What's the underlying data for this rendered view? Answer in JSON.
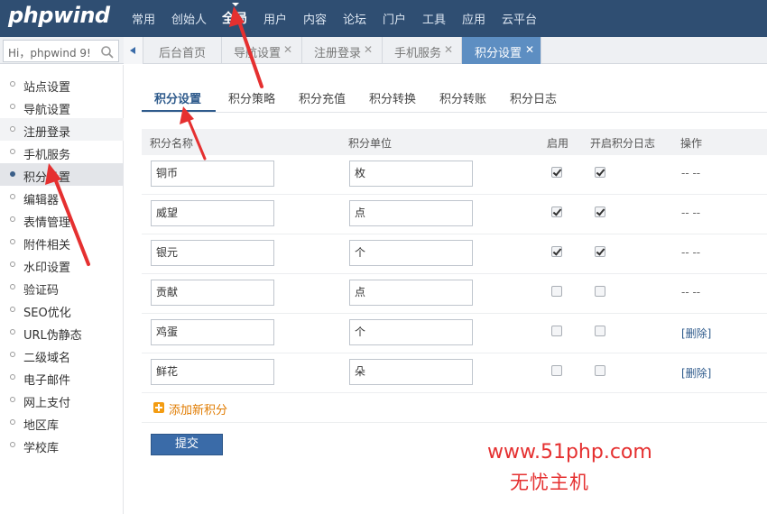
{
  "logo": "phpwind",
  "nav": {
    "items": [
      "常用",
      "创始人",
      "全局",
      "用户",
      "内容",
      "论坛",
      "门户",
      "工具",
      "应用",
      "云平台"
    ],
    "active_index": 2
  },
  "search": {
    "placeholder": "Hi，phpwind 9!"
  },
  "tabs": [
    {
      "label": "后台首页",
      "closable": false
    },
    {
      "label": "导航设置",
      "closable": true
    },
    {
      "label": "注册登录",
      "closable": true
    },
    {
      "label": "手机服务",
      "closable": true
    },
    {
      "label": "积分设置",
      "closable": true,
      "active": true
    }
  ],
  "sidebar": {
    "items": [
      {
        "label": "站点设置"
      },
      {
        "label": "导航设置"
      },
      {
        "label": "注册登录"
      },
      {
        "label": "手机服务"
      },
      {
        "label": "积分设置",
        "active": true
      },
      {
        "label": "编辑器"
      },
      {
        "label": "表情管理"
      },
      {
        "label": "附件相关"
      },
      {
        "label": "水印设置"
      },
      {
        "label": "验证码"
      },
      {
        "label": "SEO优化"
      },
      {
        "label": "URL伪静态"
      },
      {
        "label": "二级域名"
      },
      {
        "label": "电子邮件"
      },
      {
        "label": "网上支付"
      },
      {
        "label": "地区库"
      },
      {
        "label": "学校库"
      }
    ]
  },
  "subtabs": [
    "积分设置",
    "积分策略",
    "积分充值",
    "积分转换",
    "积分转账",
    "积分日志"
  ],
  "table": {
    "headers": {
      "name": "积分名称",
      "unit": "积分单位",
      "enable": "启用",
      "log": "开启积分日志",
      "op": "操作"
    },
    "rows": [
      {
        "name": "铜币",
        "unit": "枚",
        "enabled": true,
        "log": true,
        "op": "-- --"
      },
      {
        "name": "威望",
        "unit": "点",
        "enabled": true,
        "log": true,
        "op": "-- --"
      },
      {
        "name": "银元",
        "unit": "个",
        "enabled": true,
        "log": true,
        "op": "-- --"
      },
      {
        "name": "贡献",
        "unit": "点",
        "enabled": false,
        "log": false,
        "op": "-- --"
      },
      {
        "name": "鸡蛋",
        "unit": "个",
        "enabled": false,
        "log": false,
        "op": "[删除]"
      },
      {
        "name": "鲜花",
        "unit": "朵",
        "enabled": false,
        "log": false,
        "op": "[删除]"
      }
    ]
  },
  "add_label": "添加新积分",
  "submit_label": "提交",
  "watermark": {
    "line1": "www.51php.com",
    "line2": "无忧主机"
  },
  "colors": {
    "topbar": "#2f4e72",
    "accent": "#2f5b8c",
    "annotation": "#e53030"
  }
}
